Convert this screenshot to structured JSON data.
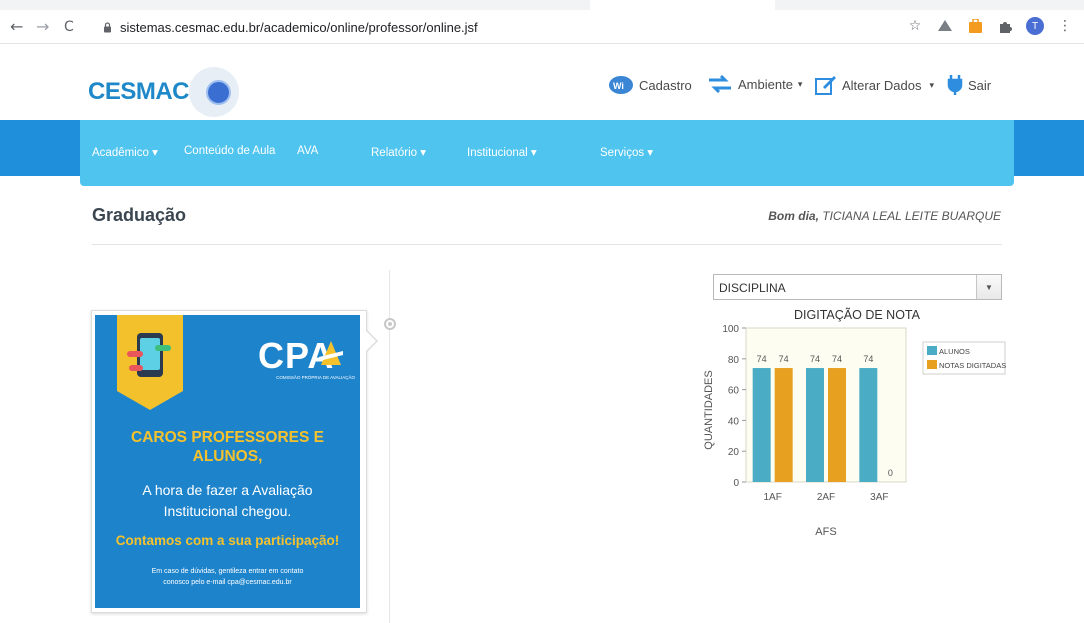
{
  "browser": {
    "back": "←",
    "forward": "→",
    "reload": "C",
    "url": "sistemas.cesmac.edu.br/academico/online/professor/online.jsf",
    "star": "☆",
    "profile_initial": "T",
    "menu": "⋮"
  },
  "header": {
    "logo": "CESMAC",
    "menu": [
      {
        "label": "Cadastro",
        "icon": "wifi-badge-icon"
      },
      {
        "label": "Ambiente",
        "icon": "swap-arrows-icon",
        "caret": "▾"
      },
      {
        "label": "Alterar Dados",
        "icon": "edit-icon",
        "caret": "▾"
      },
      {
        "label": "Sair",
        "icon": "plug-icon"
      }
    ]
  },
  "nav": {
    "items": [
      "Acadêmico ▾",
      "Conteúdo de Aula",
      "AVA",
      "Relatório ▾",
      "Institucional ▾",
      "Serviços ▾"
    ]
  },
  "page": {
    "title": "Graduação",
    "greeting_prefix": "Bom dia,",
    "greeting_name": "TICIANA LEAL LEITE BUARQUE"
  },
  "cpa_card": {
    "logo": "CPA",
    "logo_sub": "COMISSÃO PRÓPRIA DE AVALIAÇÃO",
    "headline_1": "CAROS PROFESSORES E",
    "headline_2": "ALUNOS,",
    "body_1": "A hora de fazer a Avaliação",
    "body_2": "Institucional chegou.",
    "cta": "Contamos com a sua participação!",
    "note_1": "Em caso de dúvidas, gentileza entrar em contato",
    "note_2": "conosco pelo e-mail cpa@cesmac.edu.br"
  },
  "select": {
    "value": "DISCIPLINA",
    "caret": "▼"
  },
  "colors": {
    "nav_band": "#1f8fdb",
    "nav_panel": "#4ec4ee",
    "series_alunos": "#4bacc6",
    "series_notas": "#e8a020",
    "accent_yellow": "#f6c22c"
  },
  "chart_data": {
    "type": "bar",
    "title": "DIGITAÇÃO DE NOTA",
    "xlabel": "AFS",
    "ylabel": "QUANTIDADES",
    "categories": [
      "1AF",
      "2AF",
      "3AF"
    ],
    "series": [
      {
        "name": "ALUNOS",
        "values": [
          74,
          74,
          74
        ]
      },
      {
        "name": "NOTAS DIGITADAS",
        "values": [
          74,
          74,
          0
        ]
      }
    ],
    "ylim": [
      0,
      100
    ],
    "yticks": [
      0,
      20,
      40,
      60,
      80,
      100
    ],
    "legend": "right",
    "grid": false
  }
}
